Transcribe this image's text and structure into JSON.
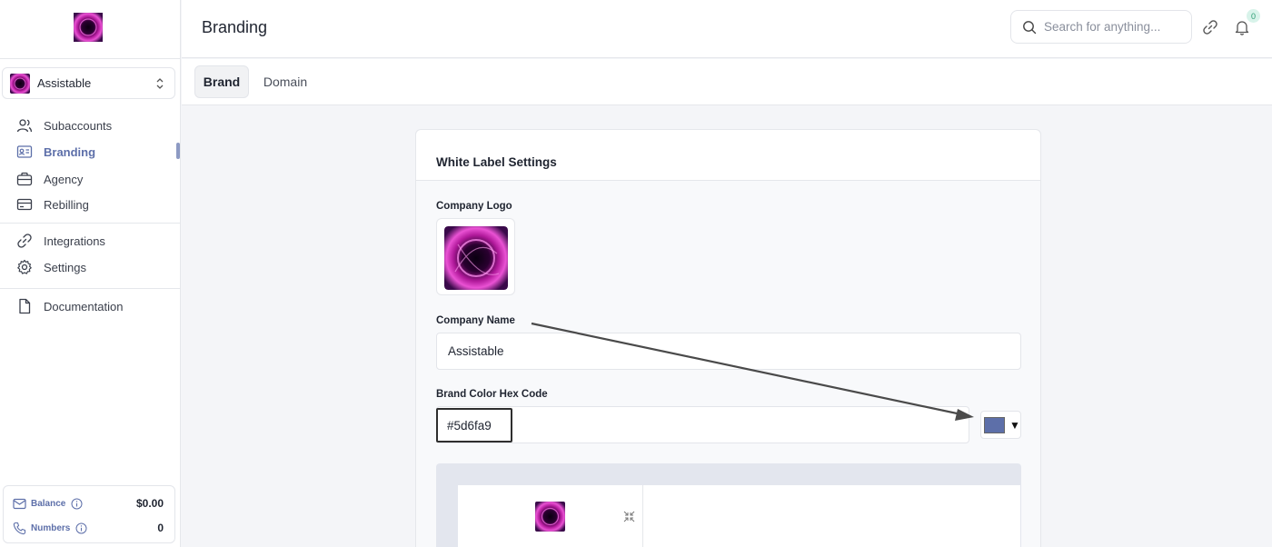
{
  "sidebar": {
    "account_name": "Assistable",
    "nav": [
      {
        "label": "Subaccounts",
        "icon": "users-icon"
      },
      {
        "label": "Branding",
        "icon": "id-card-icon",
        "active": true
      },
      {
        "label": "Agency",
        "icon": "briefcase-icon"
      },
      {
        "label": "Rebilling",
        "icon": "credit-card-icon"
      },
      {
        "label": "Integrations",
        "icon": "link-icon"
      },
      {
        "label": "Settings",
        "icon": "gear-icon"
      },
      {
        "label": "Documentation",
        "icon": "document-icon"
      }
    ],
    "balance": {
      "label": "Balance",
      "value": "$0.00"
    },
    "numbers": {
      "label": "Numbers",
      "value": "0"
    }
  },
  "header": {
    "title": "Branding",
    "search_placeholder": "Search for anything...",
    "notification_count": "0"
  },
  "tabs": [
    {
      "label": "Brand",
      "active": true
    },
    {
      "label": "Domain",
      "active": false
    }
  ],
  "card": {
    "title": "White Label Settings",
    "logo_label": "Company Logo",
    "name_label": "Company Name",
    "name_value": "Assistable",
    "color_label": "Brand Color Hex Code",
    "color_value": "#5d6fa9"
  },
  "colors": {
    "brand": "#5d6fa9",
    "logo_magenta": "#d62fb8"
  }
}
